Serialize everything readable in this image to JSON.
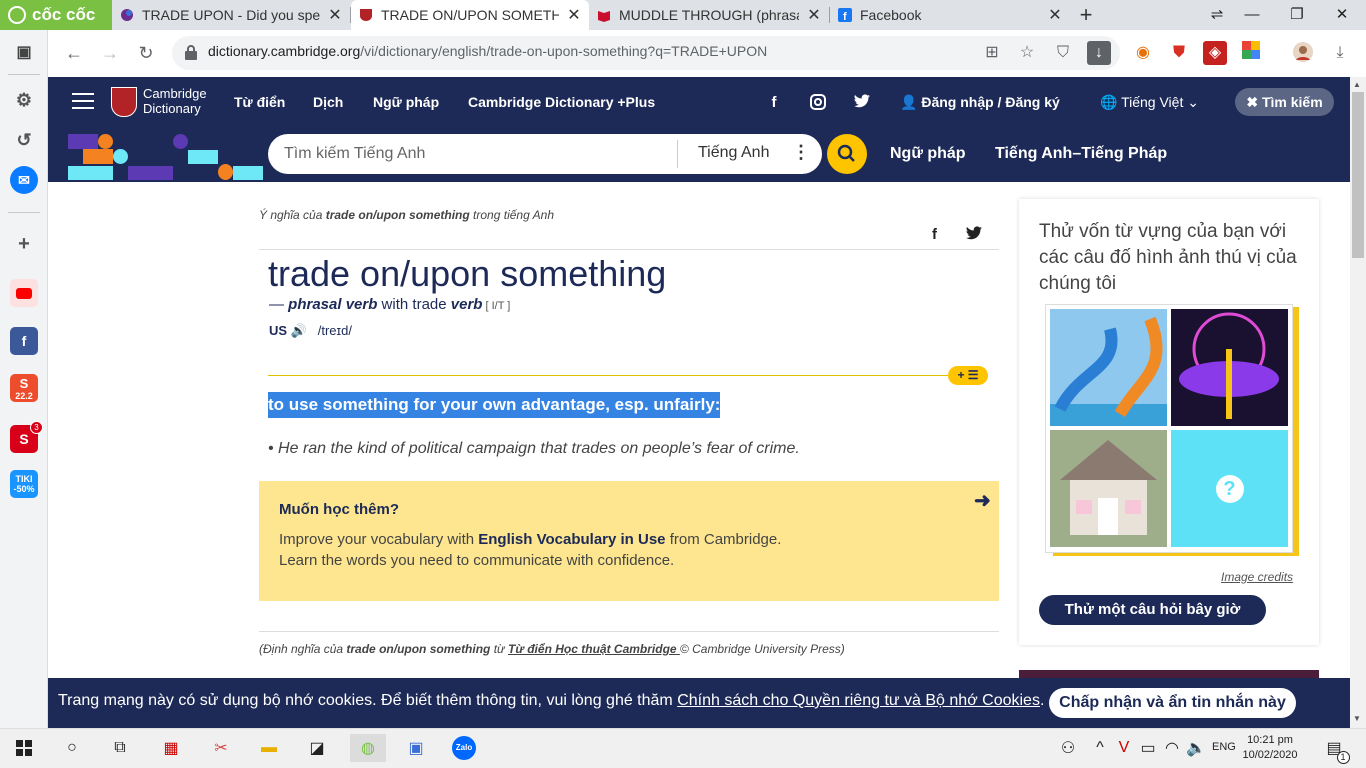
{
  "browser": {
    "brand": "cốc cốc",
    "tabs": [
      {
        "title": "TRADE UPON - Did you spell"
      },
      {
        "title": "TRADE ON/UPON SOMETHIN"
      },
      {
        "title": "MUDDLE THROUGH (phrasal"
      },
      {
        "title": "Facebook"
      }
    ],
    "url_domain": "dictionary.cambridge.org",
    "url_path": "/vi/dictionary/english/trade-on-upon-something?q=TRADE+UPON"
  },
  "site": {
    "logo_line1": "Cambridge",
    "logo_line2": "Dictionary",
    "nav": [
      "Từ điển",
      "Dịch",
      "Ngữ pháp",
      "Cambridge Dictionary +Plus"
    ],
    "login": "Đăng nhập / Đăng ký",
    "language": "Tiếng Việt",
    "search_button": "Tìm kiếm",
    "search_placeholder": "Tìm kiếm Tiếng Anh",
    "search_lang": "Tiếng Anh",
    "sub_links": [
      "Ngữ pháp",
      "Tiếng Anh–Tiếng Pháp"
    ]
  },
  "entry": {
    "breadcrumb_pre": "Ý nghĩa của ",
    "breadcrumb_word": "trade on/upon something",
    "breadcrumb_post": " trong tiếng Anh",
    "headword": "trade on/upon something",
    "pos_dash": "— ",
    "pos": "phrasal verb",
    "pos_with": " with trade ",
    "pos_verb": "verb",
    "grammar": " [ I/T ]",
    "region": "US",
    "pronunciation": "/treɪd/",
    "add_list": "+ ☰",
    "definition": "to use something for your own advantage, esp. unfairly:",
    "example": "• He ran the kind of political campaign that trades on people’s fear of crime.",
    "promo_title": "Muốn học thêm?",
    "promo_l1_pre": "Improve your vocabulary with ",
    "promo_l1_bold": "English Vocabulary in Use",
    "promo_l1_post": " from Cambridge.",
    "promo_l2": "Learn the words you need to communicate with confidence.",
    "credit_pre": "(Định nghĩa của ",
    "credit_word": "trade on/upon something",
    "credit_mid": " từ ",
    "credit_link": "Từ điển Học thuật Cambridge ",
    "credit_post": "© Cambridge University Press)"
  },
  "quiz": {
    "title": "Thử vốn từ vựng của bạn với các câu đố hình ảnh thú vị của chúng tôi",
    "image_credits": "Image credits",
    "button": "Thử một câu hỏi bây giờ",
    "mystery": "?"
  },
  "cookie": {
    "text_pre": "Trang mạng này có sử dụng bộ nhớ cookies. Để biết thêm thông tin, vui lòng ghé thăm ",
    "link": "Chính sách cho Quyền riêng tư và Bộ nhớ Cookies",
    "text_post": ".",
    "button": "Chấp nhận và ẩn tin nhắn này"
  },
  "sidebar_badges": {
    "shopee": "22.2",
    "sendo_count": "3",
    "tiki": "TIKI\n-50%"
  },
  "taskbar": {
    "lang": "ENG",
    "time": "10:21 pm",
    "date": "10/02/2020",
    "notif": "1"
  },
  "colors": {
    "navy": "#1d2a57",
    "yellow": "#fec400",
    "highlight": "#3584e4",
    "promo": "#fde68f",
    "coccoc_green": "#7ac143"
  }
}
